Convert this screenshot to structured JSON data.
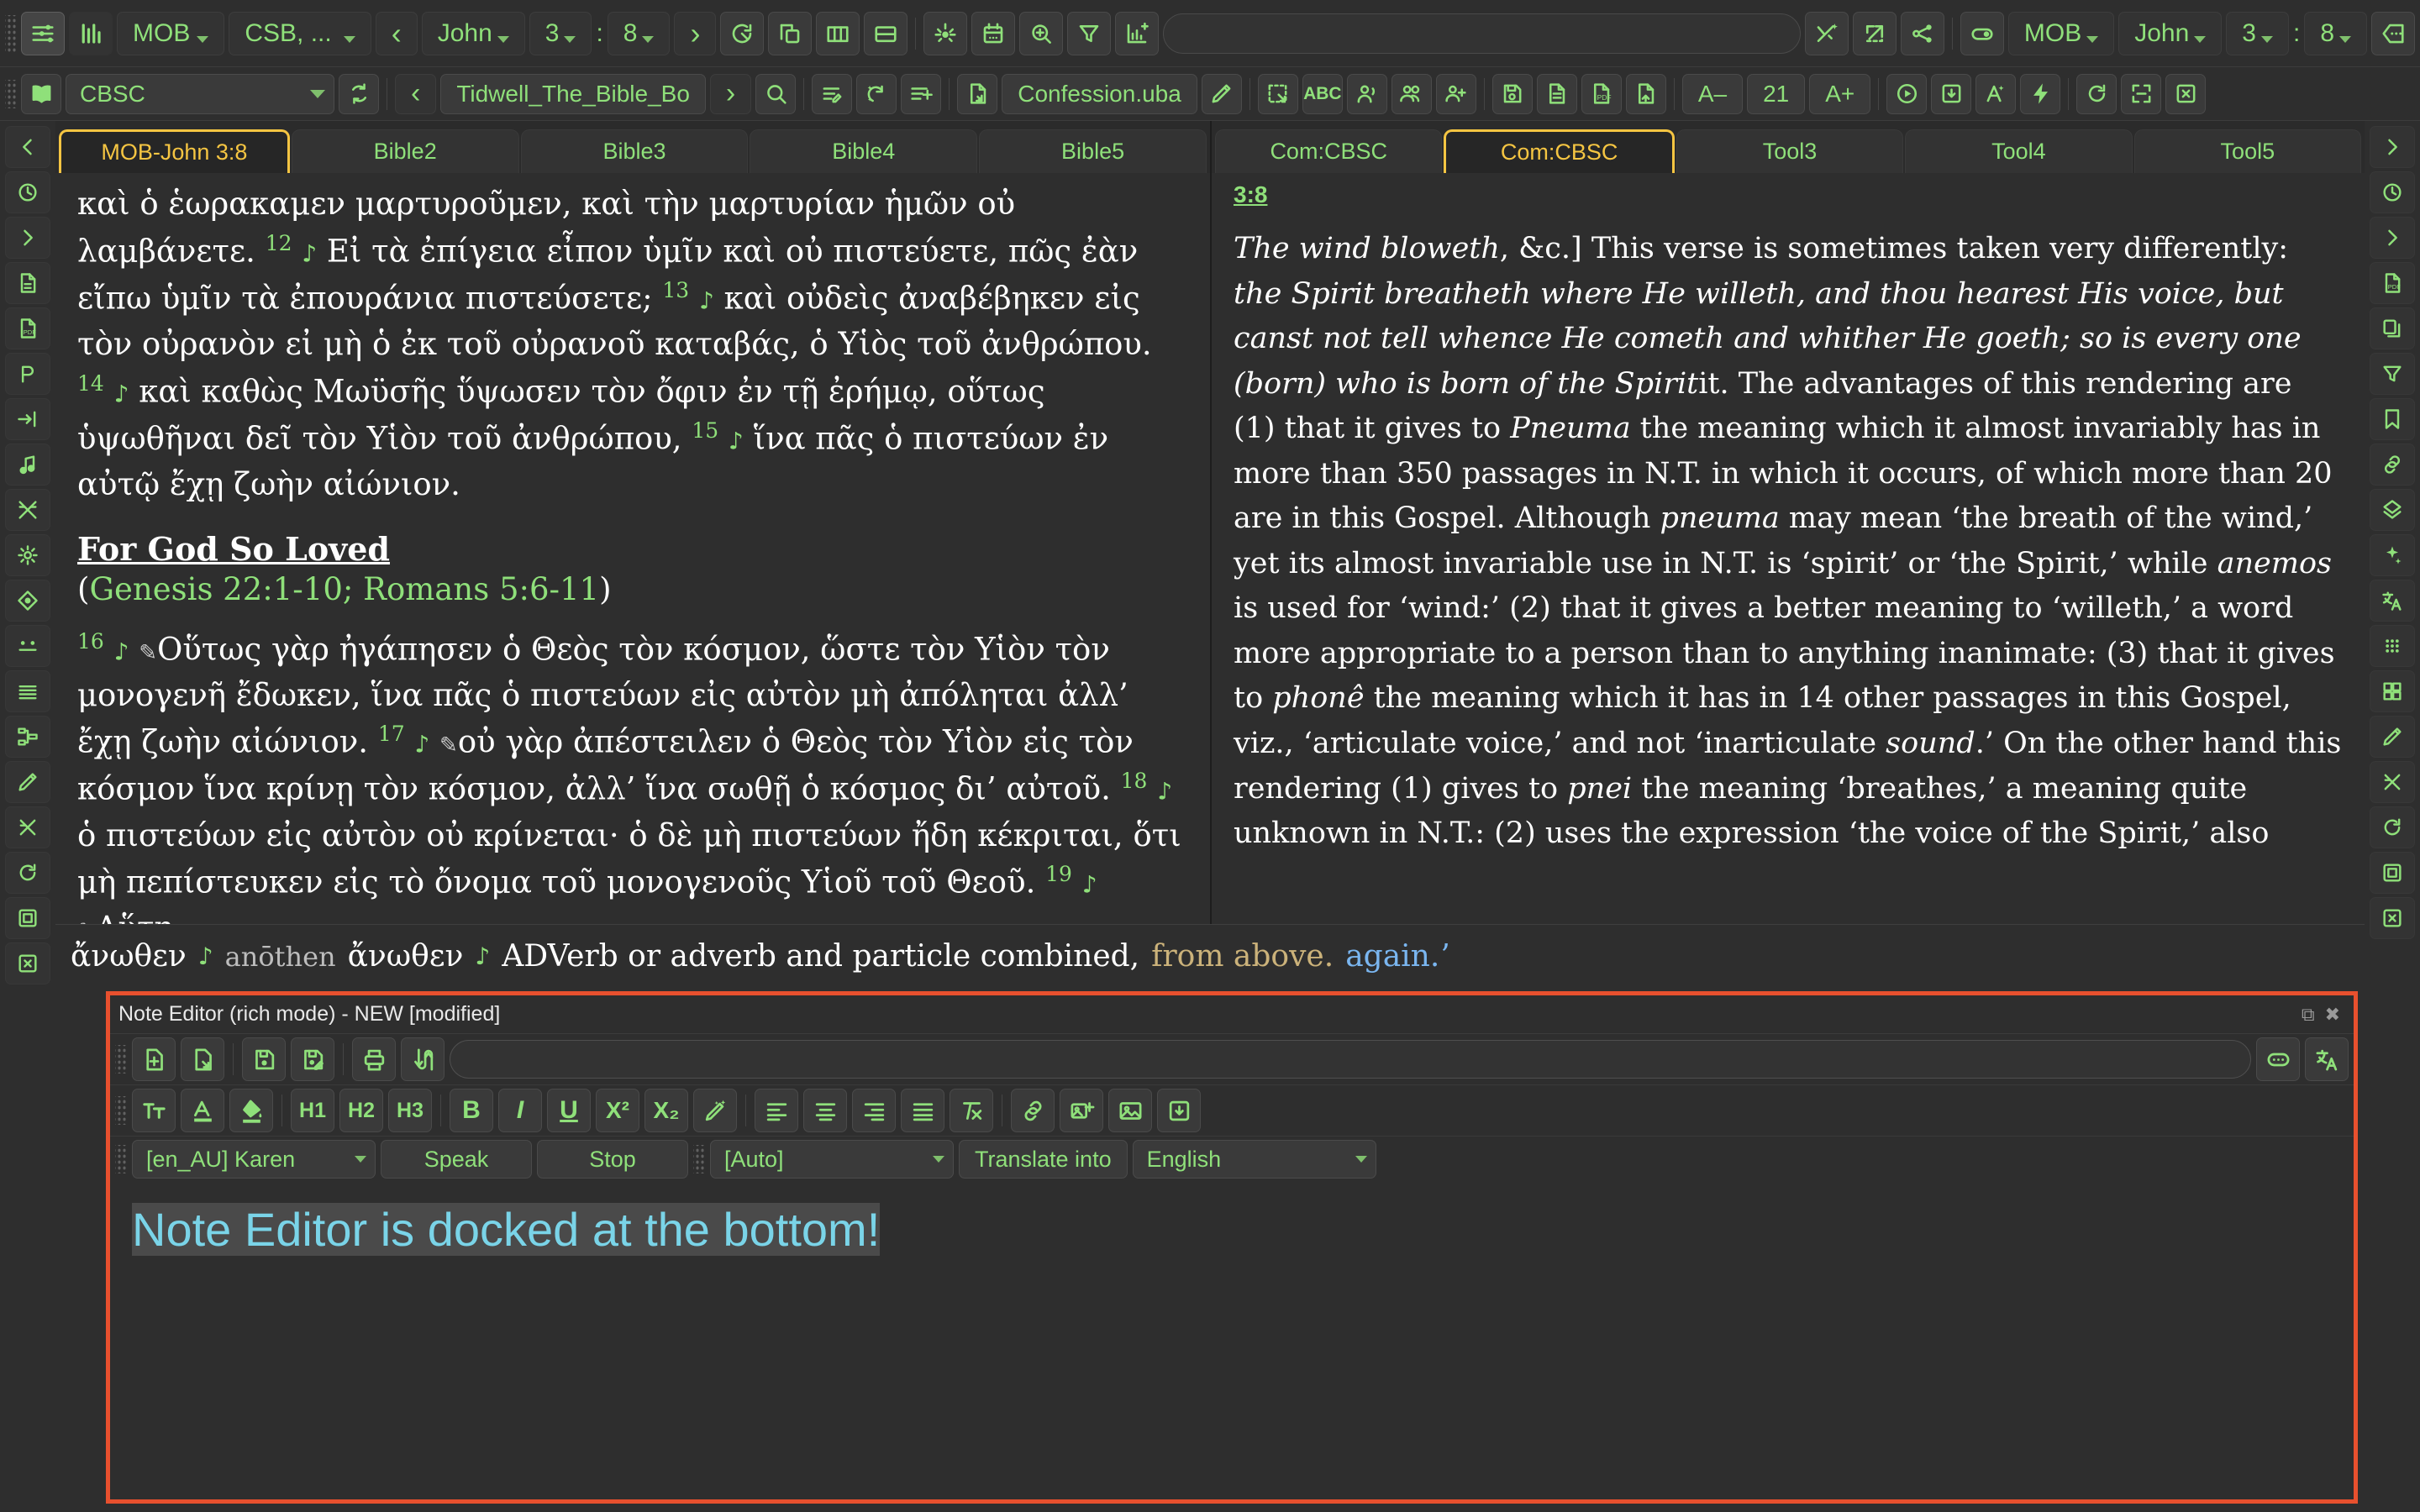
{
  "toolbar_top": {
    "module_btn": "MOB",
    "version_btn": "CSB, ...",
    "prev_label": "‹",
    "book": "John",
    "chapter": "3",
    "colon": ":",
    "verse": "8",
    "next_label": "›",
    "search_placeholder": "",
    "right_module": "MOB",
    "right_book": "John",
    "right_chapter": "3",
    "right_colon": ":",
    "right_verse": "8",
    "icons_left": [
      "layout-settings-icon",
      "chart-bars-icon"
    ],
    "icons_mid": [
      "reload-circle-icon",
      "copy-windows-icon",
      "columns-layout-icon",
      "rows-layout-icon",
      "brightness-icon",
      "calendar-icon",
      "zoom-in-icon",
      "filter-icon",
      "add-chart-icon"
    ],
    "icons_right": [
      "magic-cross-icon",
      "open-external-icon",
      "share-icon",
      "toggle-switch-icon",
      "more-options-icon"
    ]
  },
  "toolbar_second": {
    "book_icon": "open-book-icon",
    "commentary_select": "CBSC",
    "refresh_icon": "refresh-icon",
    "prev_label": "‹",
    "book_title": "Tidwell_The_Bible_Bo",
    "next_label": "›",
    "search_icon": "search-icon",
    "icons_a": [
      "edit-list-icon",
      "sparkle-add-icon",
      "add-list-icon"
    ],
    "import_icon": "import-file-icon",
    "file_name": "Confession.uba",
    "edit_icon": "pencil-icon",
    "icons_b": [
      "select-region-icon",
      "abc-icon",
      "speaker-person-icon",
      "people-icon",
      "add-people-icon",
      "save-disk-icon",
      "document-icon",
      "pdf-icon",
      "save-as-icon"
    ],
    "font_decrease": "A–",
    "font_size": "21",
    "font_increase": "A+",
    "icons_c": [
      "play-icon",
      "download-icon",
      "font-a-icon",
      "lightning-icon",
      "reload-icon",
      "fullscreen-icon",
      "close-box-icon"
    ]
  },
  "left_rail": {
    "icons": [
      "chevron-left-icon",
      "history-icon",
      "chevron-right-icon",
      "document-icon",
      "pdf-icon",
      "presentation-icon",
      "indent-icon",
      "music-note-icon",
      "shuffle-off-icon",
      "brightness-icon",
      "theme-icon",
      "dots-icon",
      "lines-icon",
      "hierarchy-icon",
      "pencil-icon",
      "cross-out-icon",
      "reload-icon",
      "fullscreen-icon",
      "close-box-icon"
    ]
  },
  "right_rail": {
    "icons": [
      "chevron-right-icon",
      "history-icon",
      "chevron-right-icon",
      "pdf-icon",
      "copy-icon",
      "filter-icon",
      "bookmark-icon",
      "link-icon",
      "tree-icon",
      "sparkle-icon",
      "translate-icon",
      "grid-dots-icon",
      "grid-squares-icon",
      "pencil-icon",
      "cross-out-icon",
      "reload-icon",
      "fullscreen-icon",
      "close-box-icon"
    ]
  },
  "left_pane": {
    "tabs": [
      {
        "label": "MOB-John 3:8",
        "selected": true
      },
      {
        "label": "Bible2",
        "selected": false
      },
      {
        "label": "Bible3",
        "selected": false
      },
      {
        "label": "Bible4",
        "selected": false
      },
      {
        "label": "Bible5",
        "selected": false
      }
    ],
    "text_lines": [
      "καὶ ὁ ἑωρακαμεν μαρτυροῦμεν, καὶ τὴν μαρτυρίαν ἡμῶν οὐ λαμβάνετε."
    ],
    "verses": [
      {
        "num": "12",
        "text": "Εἰ τὰ ἐπίγεια εἶπον ὑμῖν καὶ οὐ πιστεύετε, πῶς ἐὰν εἴπω ὑμῖν τὰ ἐπουράνια πιστεύσετε;"
      },
      {
        "num": "13",
        "text": "καὶ οὐδεὶς ἀναβέβηκεν εἰς τὸν οὐρανὸν εἰ μὴ ὁ ἐκ τοῦ οὐρανοῦ καταβάς, ὁ Υἱὸς τοῦ ἀνθρώπου."
      },
      {
        "num": "14",
        "text": "καὶ καθὼς Μωϋσῆς ὕψωσεν τὸν ὄφιν ἐν τῇ ἐρήμῳ, οὕτως ὑψωθῆναι δεῖ τὸν Υἱὸν τοῦ ἀνθρώπου,"
      },
      {
        "num": "15",
        "text": "ἵνα πᾶς ὁ πιστεύων ἐν αὐτῷ ἔχῃ ζωὴν αἰώνιον."
      }
    ],
    "section_heading": "For God So Loved",
    "section_refs_open": "(",
    "section_refs": "Genesis 22:1-10; Romans 5:6-11",
    "section_refs_close": ")",
    "verses2": [
      {
        "num": "16",
        "text": "Οὕτως γὰρ ἠγάπησεν ὁ Θεὸς τὸν κόσμον, ὥστε τὸν Υἱὸν τὸν μονογενῆ ἔδωκεν, ἵνα πᾶς ὁ πιστεύων εἰς αὐτὸν μὴ ἀπόληται ἀλλ’ ἔχῃ ζωὴν αἰώνιον."
      },
      {
        "num": "17",
        "text": "οὐ γὰρ ἀπέστειλεν ὁ Θεὸς τὸν Υἱὸν εἰς τὸν κόσμον ἵνα κρίνῃ τὸν κόσμον, ἀλλ’ ἵνα σωθῇ ὁ κόσμος δι’ αὐτοῦ."
      },
      {
        "num": "18",
        "text": "ὁ πιστεύων εἰς αὐτὸν οὐ κρίνεται· ὁ δὲ μὴ πιστεύων ἤδη κέκριται, ὅτι μὴ πεπίστευκεν εἰς τὸ ὄνομα τοῦ μονογενοῦς Υἱοῦ τοῦ Θεοῦ."
      },
      {
        "num": "19",
        "text": "Αὕτη"
      }
    ]
  },
  "right_pane": {
    "tabs": [
      {
        "label": "Com:CBSC",
        "selected": false
      },
      {
        "label": "Com:CBSC",
        "selected": true
      },
      {
        "label": "Tool3",
        "selected": false
      },
      {
        "label": "Tool4",
        "selected": false
      },
      {
        "label": "Tool5",
        "selected": false
      }
    ],
    "verse_anchor": "3:8",
    "commentary_html": "The wind bloweth, &c.] This verse is sometimes taken very differently: the Spirit breatheth where He willeth, and thou hearest His voice, but canst not tell whence He cometh and whither He goeth; so is every one (born) who is born of the Spirit. The advantages of this rendering are (1) that it gives to Pneuma the meaning which it almost invariably has in more than 350 passages in N.T. in which it occurs, of which more than 20 are in this Gospel. Although pneuma may mean ‘the breath of the wind,’ yet its almost invariable use in N.T. is ‘spirit’ or ‘the Spirit,’ while anemos is used for ‘wind:’ (2) that it gives a better meaning to ‘willeth,’ a word more appropriate to a person than to anything inanimate: (3) that it gives to phonê the meaning which it has in 14 other passages in this Gospel, viz., ‘articulate voice,’ and not ‘inarticulate sound.’ On the other hand this rendering (1) gives to pnei the meaning ‘breathes,’ a meaning quite unknown in N.T.: (2) uses the expression ‘the voice of the Spirit,’ also"
  },
  "lexicon": {
    "greek": "ἄνωθεν",
    "note1": "♪",
    "translit": "anōthen",
    "greek2": "ἄνωθεν",
    "note2": "♪",
    "morph": "ADVerb or adverb and particle combined,",
    "gloss_a": "from above.",
    "gloss_b": "again.ʼ"
  },
  "note_editor": {
    "title": "Note Editor (rich mode) - NEW [modified]",
    "restore_icon": "restore-window-icon",
    "close_icon": "close-window-icon",
    "file_icons": [
      "new-note-icon",
      "open-note-icon",
      "save-note-icon",
      "save-as-note-icon",
      "print-icon",
      "sync-icon"
    ],
    "search_placeholder": "",
    "right_icons": [
      "more-icon",
      "translate-icon"
    ],
    "format_icons": [
      "font-size-icon",
      "text-color-icon",
      "fill-color-icon"
    ],
    "heading_buttons": [
      "H1",
      "H2",
      "H3"
    ],
    "style_buttons": [
      "B",
      "I",
      "U"
    ],
    "script_buttons": [
      "X²",
      "X₂"
    ],
    "extra_icons": [
      "magic-wand-icon",
      "align-left-icon",
      "align-center-icon",
      "align-right-icon",
      "align-justify-icon",
      "clear-format-icon",
      "link-icon",
      "add-image-icon",
      "image-icon",
      "insert-icon"
    ],
    "voice_select": "[en_AU] Karen",
    "speak_button": "Speak",
    "stop_button": "Stop",
    "lang_select": "[Auto]",
    "translate_button": "Translate into",
    "target_lang": "English",
    "content": "Note Editor is docked at the bottom!"
  },
  "colors": {
    "accent_green": "#8fe07a",
    "selected_tab": "#f5c542",
    "dock_border": "#e8502e",
    "note_text": "#7ad4e8",
    "background": "#2e2e2e"
  }
}
